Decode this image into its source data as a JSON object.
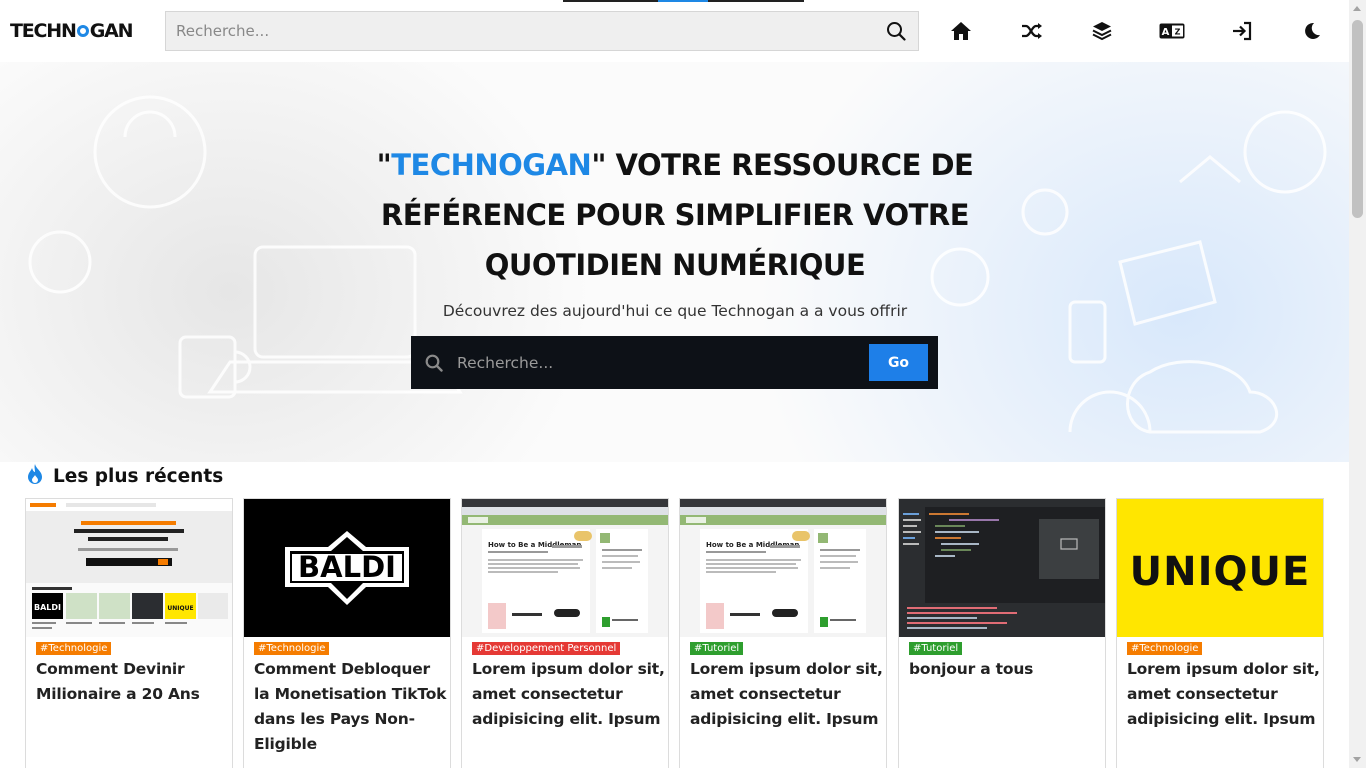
{
  "header": {
    "logo_text_left": "TECHN",
    "logo_text_right": "GAN",
    "search_placeholder": "Recherche...",
    "nav_icons": [
      "home-icon",
      "shuffle-icon",
      "layers-icon",
      "translate-icon",
      "login-icon",
      "moon-icon"
    ]
  },
  "hero": {
    "title_quote_open": "\"",
    "title_brand": "TECHNOGAN",
    "title_rest": "\" VOTRE RESSOURCE DE RÉFÉRENCE POUR SIMPLIFIER VOTRE QUOTIDIEN NUMÉRIQUE",
    "subtitle": "Découvrez des aujourd'hui ce que Technogan a a vous offrir",
    "search_placeholder": "Recherche...",
    "go_label": "Go"
  },
  "recent": {
    "heading": "Les plus récents",
    "heading_icon": "fire-icon",
    "cards": [
      {
        "tag": "#Technologie",
        "tag_color": "#f57c00",
        "title": "Comment Devinir Milionaire a 20 Ans",
        "thumb": "blog-screenshot"
      },
      {
        "tag": "#Technologie",
        "tag_color": "#f57c00",
        "title": "Comment Debloquer la Monetisation TikTok dans les Pays Non-Eligible",
        "thumb": "baldi-logo",
        "thumb_text": "BALDI"
      },
      {
        "tag": "#Developpement Personnel",
        "tag_color": "#e53935",
        "title": "Lorem ipsum dolor sit, amet consectetur adipisicing elit. Ipsum",
        "thumb": "wikihow-screenshot",
        "thumb_heading": "How to Be a Middleman"
      },
      {
        "tag": "#Tutoriel",
        "tag_color": "#2e9e2e",
        "title": "Lorem ipsum dolor sit, amet consectetur adipisicing elit. Ipsum",
        "thumb": "wikihow-screenshot",
        "thumb_heading": "How to Be a Middleman"
      },
      {
        "tag": "#Tutoriel",
        "tag_color": "#2e9e2e",
        "title": "bonjour a tous",
        "thumb": "code-editor-screenshot"
      },
      {
        "tag": "#Technologie",
        "tag_color": "#f57c00",
        "title": "Lorem ipsum dolor sit, amet consectetur adipisicing elit. Ipsum",
        "thumb": "unique-logo",
        "thumb_text": "UNIQUE"
      }
    ]
  },
  "colors": {
    "accent": "#1e88e5",
    "hero_search_bg": "#0d1117",
    "go_button": "#1e7fe8"
  }
}
